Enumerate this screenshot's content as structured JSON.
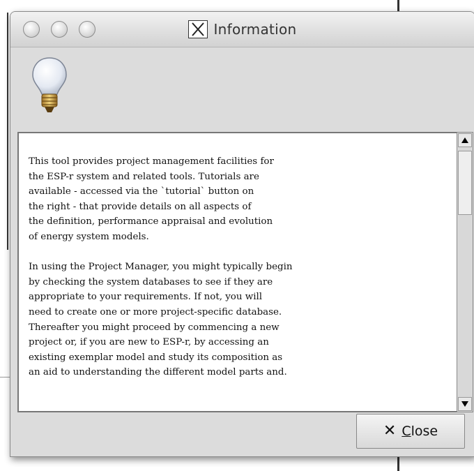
{
  "window": {
    "title": "Information",
    "title_icon": "x11-icon"
  },
  "info_icon": "lightbulb-icon",
  "text_lines": [
    "This tool provides project management facilities for",
    "the ESP-r system and related tools. Tutorials are",
    "available - accessed via the `tutorial` button on",
    "the right - that provide details on all aspects of",
    "the definition, performance appraisal and evolution",
    "of energy system models.",
    "",
    "In using the Project Manager, you might typically begin",
    "by checking the system databases to see if they are",
    "appropriate to your requirements. If not, you will",
    "need to create one or more project-specific database.",
    "Thereafter you might proceed by commencing a new",
    "project or, if you are new to ESP-r, by accessing an",
    "existing exemplar model and study its composition as",
    "an aid to understanding the different model parts and."
  ],
  "close_button": {
    "mnemonic": "C",
    "label_rest": "lose",
    "icon": "close-x-icon"
  }
}
